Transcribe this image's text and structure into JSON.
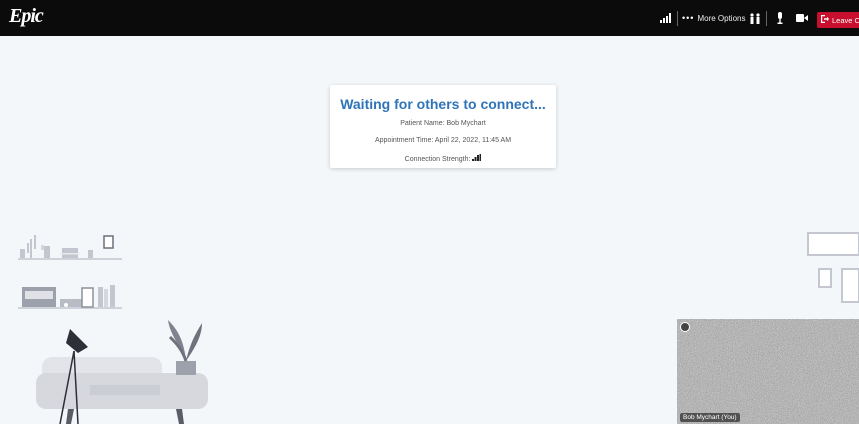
{
  "app": {
    "logo": "Epic"
  },
  "toolbar": {
    "more_options_label": "More Options",
    "leave_label": "Leave Call",
    "icons": [
      "signal-icon",
      "more-dots-icon",
      "participants-icon",
      "microphone-icon",
      "camera-icon",
      "leave-icon"
    ]
  },
  "status_card": {
    "title": "Waiting for others to connect...",
    "patient_line": "Patient Name: Bob Mychart",
    "appointment_line": "Appointment Time: April 22, 2022, 11:45 AM",
    "connection_label": "Connection Strength:"
  },
  "self_view": {
    "label": "Bob Mychart (You)"
  },
  "colors": {
    "topbar": "#0b0b0b",
    "leave_button": "#c8102e",
    "title_blue": "#2f74b8",
    "background": "#f3f7fa"
  }
}
